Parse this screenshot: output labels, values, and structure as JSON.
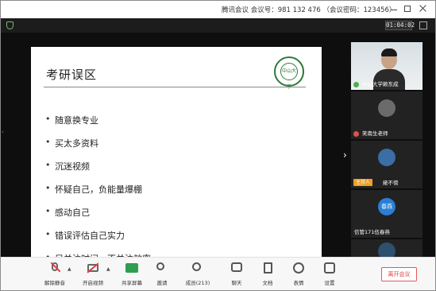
{
  "window": {
    "title": "腾讯会议 会议号：981 132 476 （会议密码：123456）"
  },
  "timer": "01:04:02",
  "slide": {
    "title": "考研误区",
    "logo_text": "中山大学",
    "bullets": [
      "随意换专业",
      "买太多资料",
      "沉迷视频",
      "怀疑自己，负能量爆棚",
      "感动自己",
      "错误评估自己实力",
      "只关注时间，不关注效率"
    ]
  },
  "participants": [
    {
      "name": "中山大学赖东成",
      "kind": "video"
    },
    {
      "name": "笑南生老师",
      "kind": "avatar"
    },
    {
      "name": "姥不傍",
      "kind": "avatar",
      "badge": "主持人"
    },
    {
      "name": "信管171伍春燕",
      "kind": "initials",
      "initials": "春燕"
    },
    {
      "name": "",
      "kind": "avatar"
    }
  ],
  "toolbar": {
    "mute": "解除静音",
    "video": "开启视频",
    "share": "共享屏幕",
    "invite": "邀请",
    "members": "成员(213)",
    "chat": "聊天",
    "docs": "文档",
    "reactions": "表情",
    "settings": "设置",
    "leave": "离开会议"
  },
  "colors": {
    "leave": "#e03c3c",
    "share_icon": "#2e9e4f",
    "host_badge": "#f0a020",
    "initials_avatar": "#2a7fd4"
  }
}
